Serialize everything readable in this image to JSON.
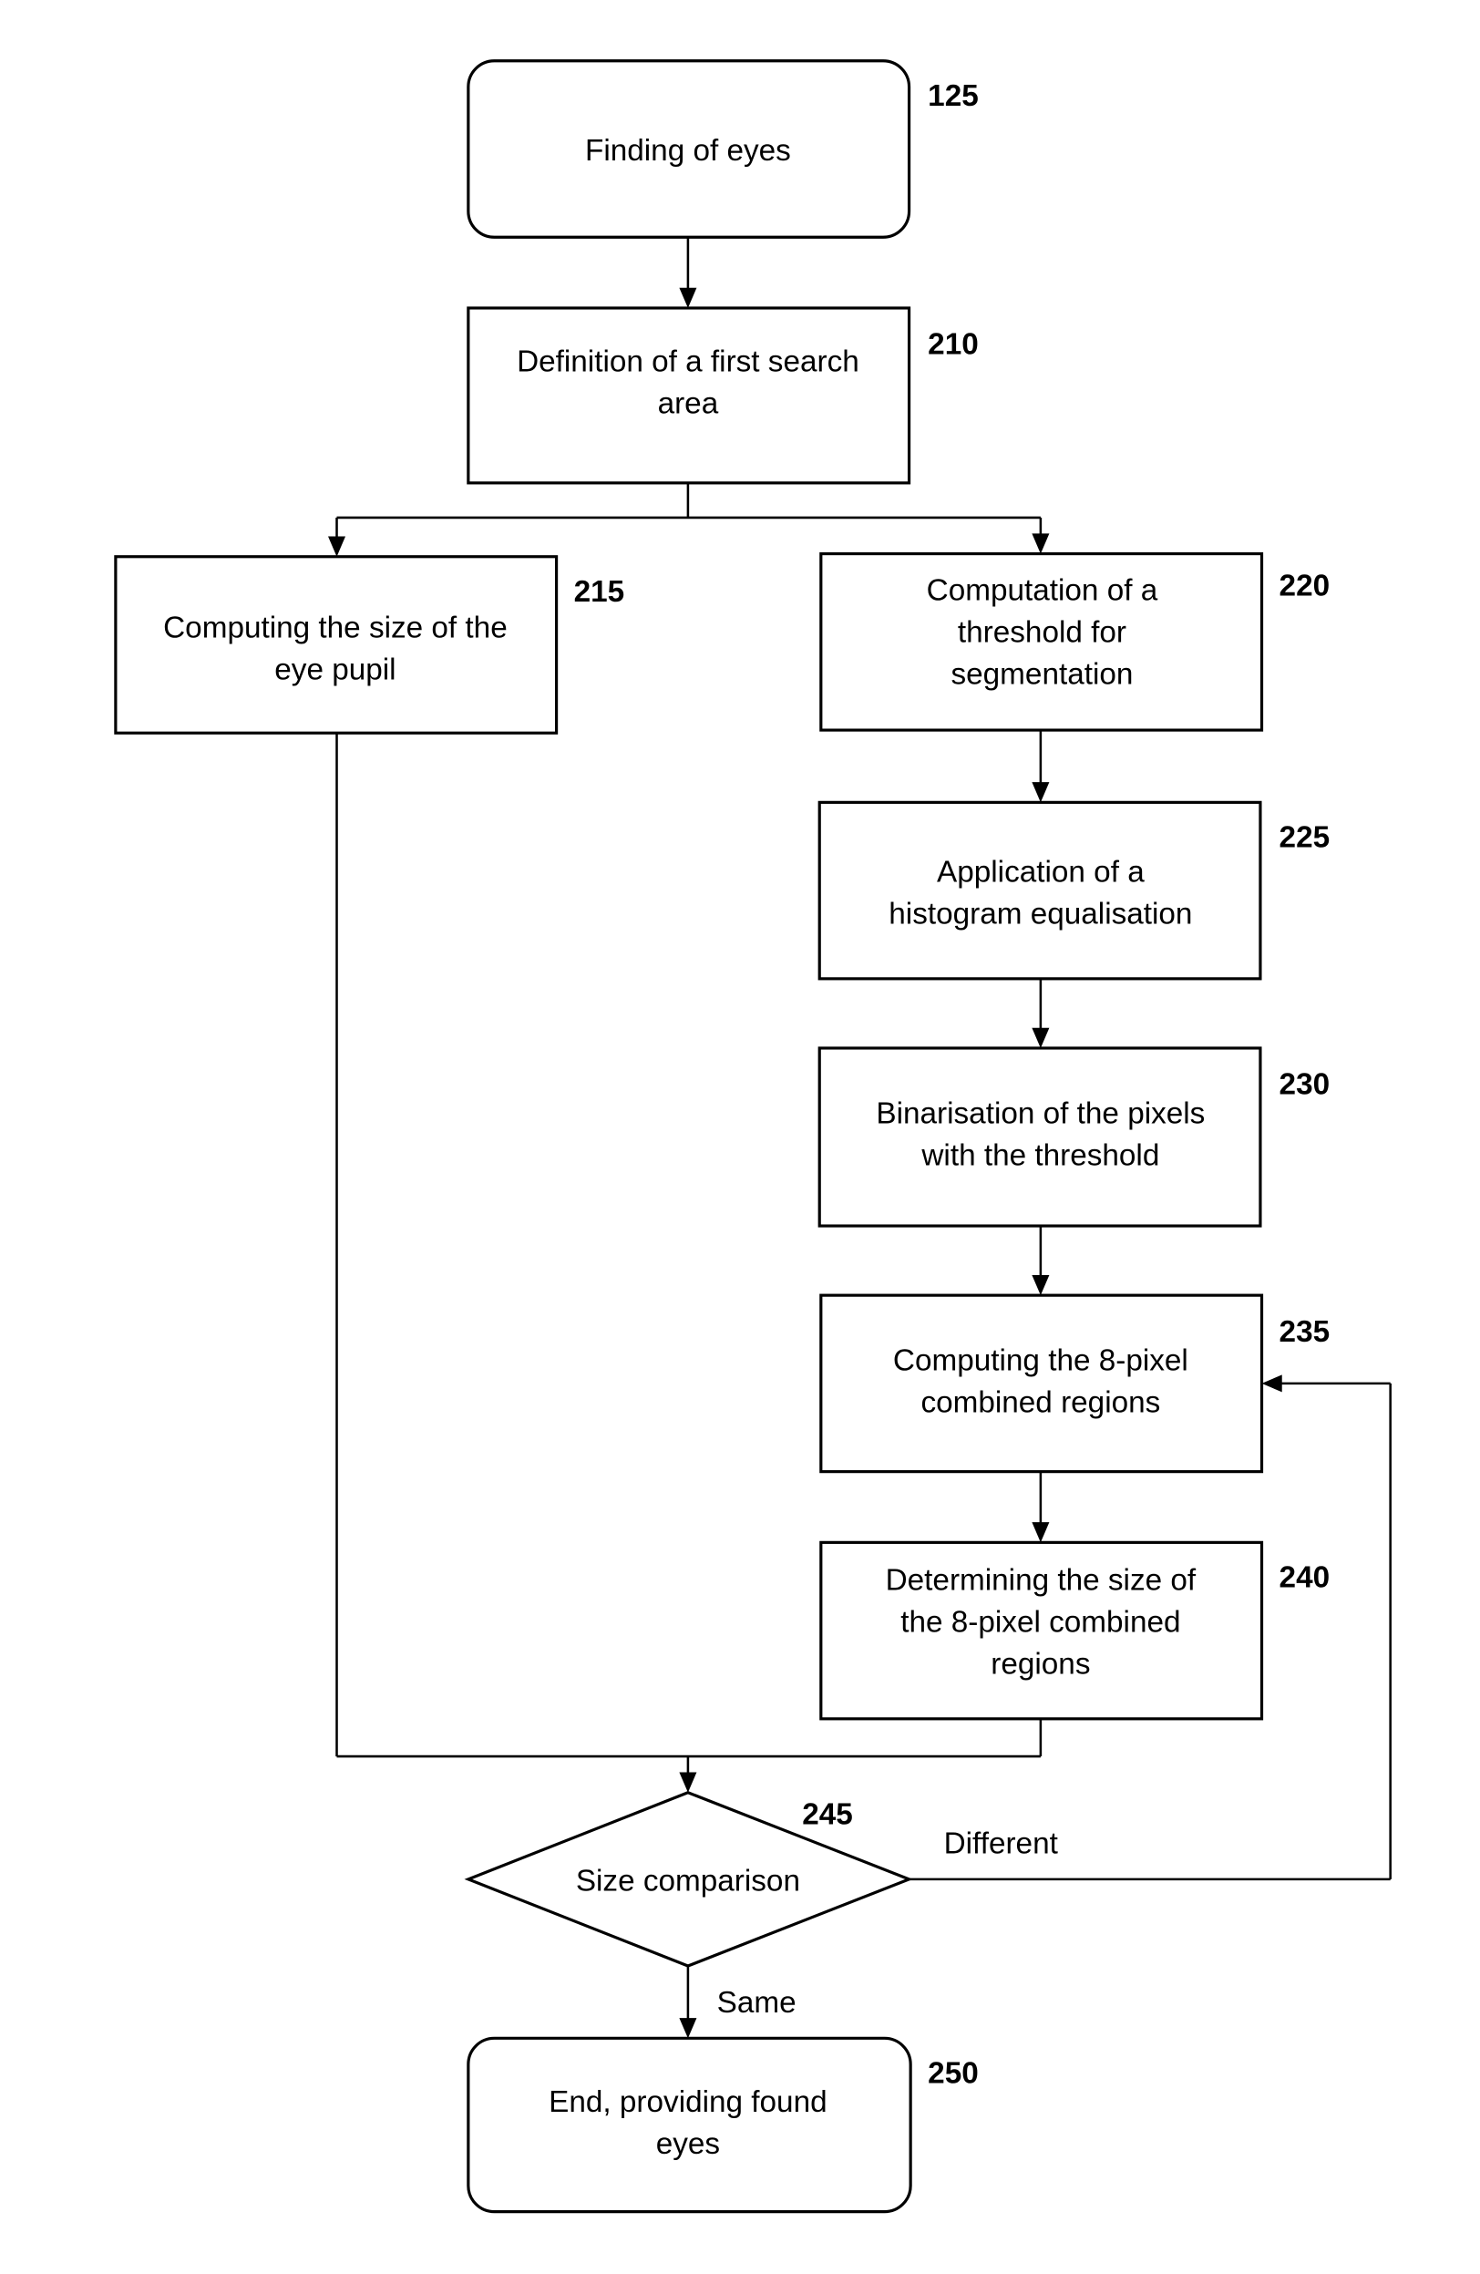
{
  "diagram": {
    "type": "flowchart",
    "nodes": [
      {
        "id": "125",
        "shape": "rounded-rect",
        "lines": [
          "Finding of eyes"
        ]
      },
      {
        "id": "210",
        "shape": "rect",
        "lines": [
          "Definition of a first search",
          "area"
        ]
      },
      {
        "id": "215",
        "shape": "rect",
        "lines": [
          "Computing the size of the",
          "eye pupil"
        ]
      },
      {
        "id": "220",
        "shape": "rect",
        "lines": [
          "Computation of a",
          "threshold for",
          "segmentation"
        ]
      },
      {
        "id": "225",
        "shape": "rect",
        "lines": [
          "Application of a",
          "histogram equalisation"
        ]
      },
      {
        "id": "230",
        "shape": "rect",
        "lines": [
          "Binarisation of the pixels",
          "with the threshold"
        ]
      },
      {
        "id": "235",
        "shape": "rect",
        "lines": [
          "Computing the 8-pixel",
          "combined regions"
        ]
      },
      {
        "id": "240",
        "shape": "rect",
        "lines": [
          "Determining the size of",
          "the 8-pixel combined",
          "regions"
        ]
      },
      {
        "id": "245",
        "shape": "diamond",
        "lines": [
          "Size comparison"
        ]
      },
      {
        "id": "250",
        "shape": "rounded-rect",
        "lines": [
          "End, providing found",
          "eyes"
        ]
      }
    ],
    "edges": [
      {
        "from": "125",
        "to": "210",
        "label": ""
      },
      {
        "from": "210",
        "to": "215",
        "label": ""
      },
      {
        "from": "210",
        "to": "220",
        "label": ""
      },
      {
        "from": "220",
        "to": "225",
        "label": ""
      },
      {
        "from": "225",
        "to": "230",
        "label": ""
      },
      {
        "from": "230",
        "to": "235",
        "label": ""
      },
      {
        "from": "235",
        "to": "240",
        "label": ""
      },
      {
        "from": "215",
        "to": "245",
        "label": ""
      },
      {
        "from": "240",
        "to": "245",
        "label": ""
      },
      {
        "from": "245",
        "to": "235",
        "label": "Different"
      },
      {
        "from": "245",
        "to": "250",
        "label": "Same"
      }
    ]
  },
  "refs": {
    "n125": "125",
    "n210": "210",
    "n215": "215",
    "n220": "220",
    "n225": "225",
    "n230": "230",
    "n235": "235",
    "n240": "240",
    "n245": "245",
    "n250": "250"
  },
  "text": {
    "n125": [
      "Finding of eyes"
    ],
    "n210": [
      "Definition of a first search",
      "area"
    ],
    "n215": [
      "Computing the size of the",
      "eye pupil"
    ],
    "n220": [
      "Computation of a",
      "threshold for",
      "segmentation"
    ],
    "n225": [
      "Application of a",
      "histogram equalisation"
    ],
    "n230": [
      "Binarisation of the pixels",
      "with the threshold"
    ],
    "n235": [
      "Computing the 8-pixel",
      "combined regions"
    ],
    "n240": [
      "Determining the size of",
      "the 8-pixel combined",
      "regions"
    ],
    "n245": [
      "Size comparison"
    ],
    "n250": [
      "End, providing found",
      "eyes"
    ]
  },
  "edge_labels": {
    "different": "Different",
    "same": "Same"
  }
}
